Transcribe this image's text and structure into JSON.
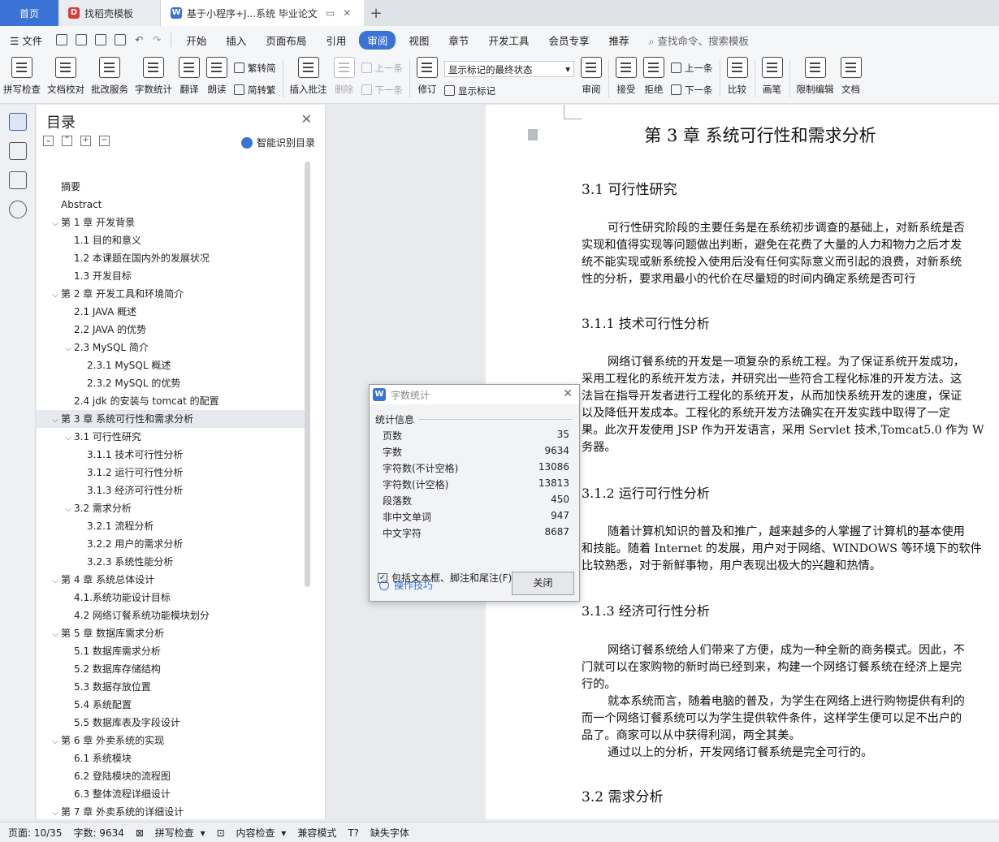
{
  "tabs": {
    "home": "首页",
    "template": "找稻壳模板",
    "doc": "基于小程序+J...系统 毕业论文"
  },
  "menu": {
    "file": "文件",
    "items": [
      "开始",
      "插入",
      "页面布局",
      "引用",
      "审阅",
      "视图",
      "章节",
      "开发工具",
      "会员专享",
      "推荐"
    ],
    "active": "审阅",
    "search": "查找命令、搜索模板"
  },
  "ribbon": {
    "spell": "拼写检查",
    "proof": "文档校对",
    "batch": "批改服务",
    "wordcount": "字数统计",
    "translate": "翻译",
    "read": "朗读",
    "trad": "繁转简",
    "simp": "简转繁",
    "insert_comment": "插入批注",
    "delete": "删除",
    "prev": "上一条",
    "next": "下一条",
    "revise": "修订",
    "markup_select": "显示标记的最终状态",
    "show_markup": "显示标记",
    "review": "审阅",
    "accept": "接受",
    "reject": "拒绝",
    "prev2": "上一条",
    "next2": "下一条",
    "compare": "比较",
    "pen": "画笔",
    "restrict": "限制编辑",
    "doc_more": "文档"
  },
  "toc": {
    "title": "目录",
    "smart": "智能识别目录",
    "items": [
      {
        "text": "摘要",
        "level": 0,
        "caret": false
      },
      {
        "text": "Abstract",
        "level": 0,
        "caret": false
      },
      {
        "text": "第 1 章  开发背景",
        "level": 0,
        "caret": true
      },
      {
        "text": "1.1  目的和意义",
        "level": 1,
        "caret": false
      },
      {
        "text": "1.2 本课题在国内外的发展状况",
        "level": 1,
        "caret": false
      },
      {
        "text": "1.3  开发目标",
        "level": 1,
        "caret": false
      },
      {
        "text": "第 2 章  开发工具和环境简介",
        "level": 0,
        "caret": true
      },
      {
        "text": "2.1 JAVA 概述",
        "level": 1,
        "caret": false
      },
      {
        "text": "2.2 JAVA 的优势",
        "level": 1,
        "caret": false
      },
      {
        "text": "2.3 MySQL 简介",
        "level": 1,
        "caret": true
      },
      {
        "text": "2.3.1 MySQL 概述",
        "level": 2,
        "caret": false
      },
      {
        "text": "2.3.2 MySQL 的优势",
        "level": 2,
        "caret": false
      },
      {
        "text": "2.4 jdk 的安装与 tomcat 的配置",
        "level": 1,
        "caret": false
      },
      {
        "text": "第 3 章  系统可行性和需求分析",
        "level": 0,
        "caret": true,
        "selected": true
      },
      {
        "text": "3.1 可行性研究",
        "level": 1,
        "caret": true
      },
      {
        "text": "3.1.1 技术可行性分析",
        "level": 2,
        "caret": false
      },
      {
        "text": "3.1.2 运行可行性分析",
        "level": 2,
        "caret": false
      },
      {
        "text": "3.1.3 经济可行性分析",
        "level": 2,
        "caret": false
      },
      {
        "text": "3.2 需求分析",
        "level": 1,
        "caret": true
      },
      {
        "text": "3.2.1 流程分析",
        "level": 2,
        "caret": false
      },
      {
        "text": "3.2.2 用户的需求分析",
        "level": 2,
        "caret": false
      },
      {
        "text": "3.2.3 系统性能分析",
        "level": 2,
        "caret": false
      },
      {
        "text": "第 4 章  系统总体设计",
        "level": 0,
        "caret": true
      },
      {
        "text": "4.1.系统功能设计目标",
        "level": 1,
        "caret": false
      },
      {
        "text": "4.2  网络订餐系统功能模块划分",
        "level": 1,
        "caret": false
      },
      {
        "text": "第 5 章  数据库需求分析",
        "level": 0,
        "caret": true
      },
      {
        "text": "5.1 数据库需求分析",
        "level": 1,
        "caret": false
      },
      {
        "text": "5.2 数据库存储结构",
        "level": 1,
        "caret": false
      },
      {
        "text": "5.3  数据存放位置",
        "level": 1,
        "caret": false
      },
      {
        "text": "5.4  系统配置",
        "level": 1,
        "caret": false
      },
      {
        "text": "5.5 数据库表及字段设计",
        "level": 1,
        "caret": false
      },
      {
        "text": "第 6 章  外卖系统的实现",
        "level": 0,
        "caret": true
      },
      {
        "text": "6.1 系统模块",
        "level": 1,
        "caret": false
      },
      {
        "text": "6.2  登陆模块的流程图",
        "level": 1,
        "caret": false
      },
      {
        "text": "6.3  整体流程详细设计",
        "level": 1,
        "caret": false
      },
      {
        "text": "第 7 章  外卖系统的详细设计",
        "level": 0,
        "caret": true
      }
    ]
  },
  "document": {
    "chapter_title": "第 3 章  系统可行性和需求分析",
    "s31": "3.1 可行性研究",
    "p1": "可行性研究阶段的主要任务是在系统初步调查的基础上，对新系统是否\n实现和值得实现等问题做出判断，避免在花费了大量的人力和物力之后才发\n统不能实现或新系统投入使用后没有任何实际意义而引起的浪费，对新系统\n性的分析，要求用最小的代价在尽量短的时间内确定系统是否可行",
    "s311": "3.1.1 技术可行性分析",
    "p2": "网络订餐系统的开发是一项复杂的系统工程。为了保证系统开发成功，\n采用工程化的系统开发方法，并研究出一些符合工程化标准的开发方法。这\n法旨在指导开发者进行工程化的系统开发，从而加快系统开发的速度，保证\n以及降低开发成本。工程化的系统开发方法确实在开发实践中取得了一定\n果。此次开发使用 JSP 作为开发语言，采用 Servlet 技术,Tomcat5.0 作为 W\n务器。",
    "s312": "3.1.2 运行可行性分析",
    "p3": "随着计算机知识的普及和推广，越来越多的人掌握了计算机的基本使用\n和技能。随着 Internet 的发展，用户对于网络、WINDOWS 等环境下的软件\n比较熟悉，对于新鲜事物，用户表现出极大的兴趣和热情。",
    "s313": "3.1.3 经济可行性分析",
    "p4": "网络订餐系统给人们带来了方便，成为一种全新的商务模式。因此，不\n门就可以在家购物的新时尚已经到来，构建一个网络订餐系统在经济上是完\n行的。",
    "p5": "就本系统而言，随着电脑的普及，为学生在网络上进行购物提供有利的\n而一个网络订餐系统可以为学生提供软件条件，这样学生便可以足不出户的\n品了。商家可以从中获得利润，两全其美。",
    "p6": "通过以上的分析，开发网络订餐系统是完全可行的。",
    "s32": "3.2 需求分析"
  },
  "dialog": {
    "title": "字数统计",
    "section": "统计信息",
    "stats": [
      {
        "label": "页数",
        "value": "35"
      },
      {
        "label": "字数",
        "value": "9634"
      },
      {
        "label": "字符数(不计空格)",
        "value": "13086"
      },
      {
        "label": "字符数(计空格)",
        "value": "13813"
      },
      {
        "label": "段落数",
        "value": "450"
      },
      {
        "label": "非中文单词",
        "value": "947"
      },
      {
        "label": "中文字符",
        "value": "8687"
      }
    ],
    "include": "包括文本框、脚注和尾注(F)",
    "include_checked": true,
    "tips": "操作技巧",
    "close": "关闭"
  },
  "status": {
    "page": "页面: 10/35",
    "words": "字数: 9634",
    "spell": "拼写检查",
    "content": "内容检查",
    "compat": "兼容模式",
    "font": "缺失字体"
  }
}
